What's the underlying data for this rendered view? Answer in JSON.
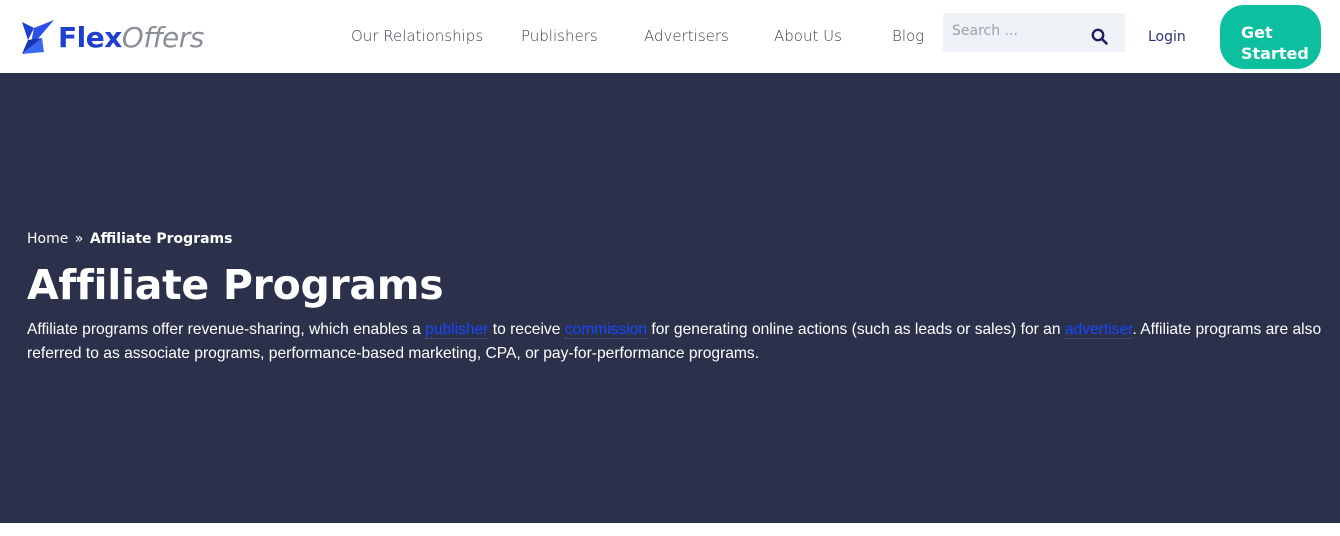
{
  "header": {
    "logo": {
      "flex": "Flex",
      "offers": "Offers",
      "icon": "flexoffers-logo-icon"
    },
    "nav": [
      {
        "label": "Our Relationships"
      },
      {
        "label": "Publishers"
      },
      {
        "label": "Advertisers"
      },
      {
        "label": "About Us"
      },
      {
        "label": "Blog"
      }
    ],
    "search": {
      "placeholder": "Search ...",
      "value": "",
      "icon": "search-icon"
    },
    "login_label": "Login",
    "cta_line1": "Get",
    "cta_line2": "Started"
  },
  "hero": {
    "breadcrumb": {
      "home": "Home",
      "separator": "»",
      "current": "Affiliate Programs"
    },
    "title": "Affiliate Programs",
    "intro": {
      "part1": "Affiliate programs offer revenue-sharing, which enables a ",
      "link1": "publisher",
      "part2": " to receive ",
      "link2": "commission",
      "part3": " for generating online actions (such as leads or sales) for an ",
      "link3": "advertiser",
      "part4": ". Affiliate programs are also referred to as associate programs, performance-based marketing, CPA, or pay-for-performance programs."
    }
  },
  "colors": {
    "brand_blue": "#1f3fcf",
    "hero_background": "#2b314b",
    "cta_green": "#0cbf9f",
    "link_blue": "#1746ff"
  }
}
